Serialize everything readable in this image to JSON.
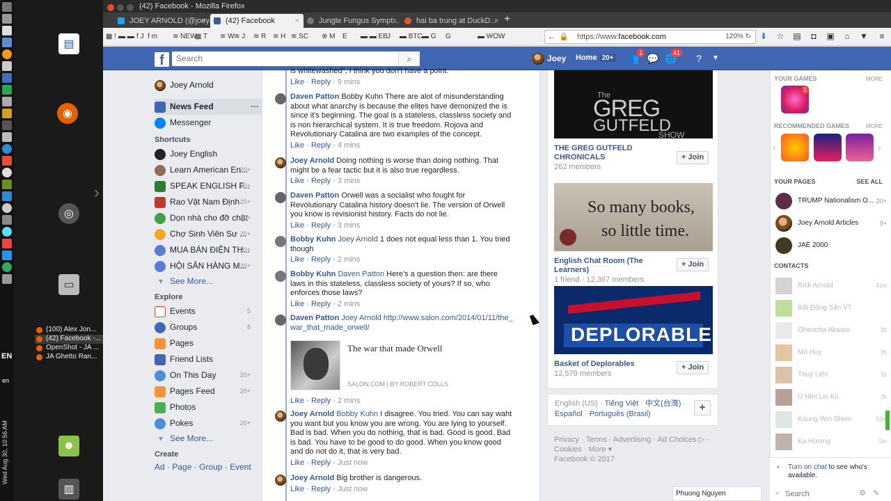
{
  "os": {
    "clock": "Wed Aug 30, 10:56 AM",
    "lang": "EN",
    "lang_small": "en",
    "taskbar": [
      {
        "label": "(100) Alex Jon...",
        "active": false
      },
      {
        "label": "(42) Facebook -...",
        "active": true
      },
      {
        "label": "OpenShot - JA ...",
        "active": false
      },
      {
        "label": "JA Ghetto Ran...",
        "active": false
      }
    ]
  },
  "window": {
    "title": "(42) Facebook - Mozilla Firefox"
  },
  "tabs": [
    {
      "label": "JOEY ARNOLD (@joeya...",
      "active": false,
      "color": "#1da1f2"
    },
    {
      "label": "(42) Facebook",
      "active": true,
      "color": "#3b5998"
    },
    {
      "label": "Jungle Fungus Sympt...",
      "active": false,
      "color": "#888888"
    },
    {
      "label": "hai ba trung at DuckD...",
      "active": false,
      "color": "#de5833"
    }
  ],
  "toolbar": {
    "bookmarks": [
      "!",
      "J",
      "m",
      "NEW",
      "T",
      "W",
      "J",
      "R",
      "H",
      "SC",
      "M",
      "E",
      "EB",
      "J",
      "BTC",
      "G",
      "G",
      "WOW"
    ],
    "url_prefix": "https://www.",
    "url_host": "facebook.com",
    "zoom": "120%"
  },
  "fb": {
    "search_placeholder": "Search",
    "user_name": "Joey",
    "home_label": "Home",
    "home_count": "20+",
    "friend_badge": "1",
    "notif_badge": "41"
  },
  "left": {
    "profile_name": "Joey Arnold",
    "main": [
      {
        "label": "News Feed",
        "selected": true
      },
      {
        "label": "Messenger",
        "selected": false
      }
    ],
    "shortcuts_title": "Shortcuts",
    "shortcuts": [
      {
        "label": "Joey English",
        "count": ""
      },
      {
        "label": "Learn American En...",
        "count": "20+"
      },
      {
        "label": "SPEAK ENGLISH F...",
        "count": "20+"
      },
      {
        "label": "Rao Vặt Nam Định",
        "count": "20+"
      },
      {
        "label": "Dọn nhà cho đỡ chật",
        "count": "20+"
      },
      {
        "label": "Chợ Sinh Viên Sư ...",
        "count": "20+"
      },
      {
        "label": "MUA BÁN ĐIỆN TH...",
        "count": "20+"
      },
      {
        "label": "HỘI SĂN HÀNG M...",
        "count": "20+"
      }
    ],
    "see_more": "See More...",
    "explore_title": "Explore",
    "explore": [
      {
        "label": "Events",
        "count": "5"
      },
      {
        "label": "Groups",
        "count": "8"
      },
      {
        "label": "Pages",
        "count": ""
      },
      {
        "label": "Friend Lists",
        "count": ""
      },
      {
        "label": "On This Day",
        "count": "20+"
      },
      {
        "label": "Pages Feed",
        "count": "20+"
      },
      {
        "label": "Photos",
        "count": ""
      },
      {
        "label": "Pokes",
        "count": "20+"
      }
    ],
    "see_more2": "See More...",
    "create_title": "Create",
    "create_links": [
      "Ad",
      "Page",
      "Group",
      "Event"
    ]
  },
  "comments": [
    {
      "name": "",
      "mention": "",
      "text": "is whitewashed\", I think you don't have a point.",
      "time": "9 mins"
    },
    {
      "name": "Daven Patton",
      "mention": "",
      "text": "Bobby Kuhn There are alot of misunderstanding about what anarchy is because the elites have demonized the is since it's beginning. The goal is a stateless, classless society and is non hierarchical system. It is true freedom. Rojova and Revolutionary Catalina are two examples of the concept.",
      "time": "4 mins"
    },
    {
      "name": "Joey Arnold",
      "mention": "",
      "text": "Doing nothing is worse than doing nothing. That might be a fear tactic but it is also true regardless.",
      "time": "3 mins"
    },
    {
      "name": "Daven Patton",
      "mention": "",
      "text": "Orwell was a socialist who fought for Revolutionary Catalina history doesn't lie. The version of Orwell you know is revisionist history. Facts do not lie.",
      "time": "3 mins"
    },
    {
      "name": "Bobby Kuhn",
      "mention": "Joey Arnold",
      "text": "1 does not equal less than 1. You tried though",
      "time": "2 mins"
    },
    {
      "name": "Bobby Kuhn",
      "mention": "Daven Patton",
      "text": "Here's a question then: are there laws in this stateless, classless society of yours? If so, who enforces those laws?",
      "time": "2 mins"
    },
    {
      "name": "Daven Patton",
      "mention": "Joey Arnold",
      "text": "http://www.salon.com/2014/01/11/the_war_that_made_orwell/",
      "time": "2 mins"
    },
    {
      "name": "Joey Arnold",
      "mention": "Bobby Kuhn",
      "text": "I disagree. You tried. You can say waht you want but you know you are wrong. You are lying to yourself. Bad is bad. When you do nothing, that is bad. Good is good. Bad is bad. You have to be good to do good. When you know good and do not do it, that is very bad.",
      "time": "Just now"
    },
    {
      "name": "Joey Arnold",
      "mention": "",
      "text": "Big brother is dangerous.",
      "time": "Just now"
    }
  ],
  "actions": {
    "like": "Like",
    "reply": "Reply",
    "sep": "·"
  },
  "link_preview": {
    "title": "The war that made Orwell",
    "source": "SALON.COM",
    "author": "BY ROBERT COLLS",
    "sep": "|"
  },
  "groups": [
    {
      "name": "THE GREG GUTFELD CHRONICALS",
      "members": "262 members",
      "join": "Join",
      "art1": "The",
      "art2": "GREG",
      "art3": "GUTFELD",
      "art4": "SHOW"
    },
    {
      "name": "English Chat Room (The Learners)",
      "members": "1 friend · 12,367 members",
      "join": "Join",
      "art1": "So many books,",
      "art2": "so little time."
    },
    {
      "name": "Basket of Deplorables",
      "members": "12,579 members",
      "join": "Join",
      "art1": "DEPLORABLE"
    }
  ],
  "languages": {
    "line1": [
      "English (US)",
      "Tiếng Việt",
      "中文(台灣)"
    ],
    "line2": [
      "Español",
      "Português (Brasil)"
    ],
    "sep": "·"
  },
  "footer": {
    "links1": [
      "Privacy",
      "Terms",
      "Advertising",
      "Ad Choices"
    ],
    "links2": [
      "Cookies",
      "More ▾"
    ],
    "copyright": "Facebook © 2017"
  },
  "chat_tab_name": "Phuong Nguyen",
  "right": {
    "your_games": "YOUR GAMES",
    "more": "MORE",
    "game_badge": "1",
    "recommended": "RECOMMENDED GAMES",
    "more2": "MORE",
    "your_pages": "YOUR PAGES",
    "see_all": "SEE ALL",
    "pages": [
      {
        "name": "TRUMP Nationalism O...",
        "count": "20+"
      },
      {
        "name": "Joey Arnold Articles",
        "count": "9+"
      },
      {
        "name": "JAE 2000",
        "count": ""
      }
    ],
    "contacts_title": "CONTACTS",
    "contacts": [
      {
        "name": "Rick Arnold",
        "time": "41m"
      },
      {
        "name": "Bất Động Sản VT",
        "time": ""
      },
      {
        "name": "Oheneba Akwasi",
        "time": "2h"
      },
      {
        "name": "Mít Huy",
        "time": "2h"
      },
      {
        "name": "Thuý Liên",
        "time": "1h"
      },
      {
        "name": "U Hlet Lin Ko",
        "time": "2h"
      },
      {
        "name": "Kaung Win Shein",
        "time": "52m"
      },
      {
        "name": "Ka Hương",
        "time": "5m"
      }
    ],
    "turn_on_link": "Turn on chat",
    "turn_on_rest": " to see who's available.",
    "search_placeholder": "Search"
  }
}
